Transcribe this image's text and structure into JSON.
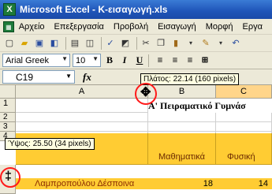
{
  "window": {
    "title": "Microsoft Excel - K-εισαγωγή.xls"
  },
  "menu": [
    "Αρχείο",
    "Επεξεργασία",
    "Προβολή",
    "Εισαγωγή",
    "Μορφή",
    "Εργα"
  ],
  "format_toolbar": {
    "font": "Arial Greek",
    "size": "10",
    "bold": "B",
    "italic": "I",
    "underline": "U"
  },
  "formula_bar": {
    "cell_ref": "C19",
    "fx": "fx"
  },
  "tooltips": {
    "column_width": "Πλάτος: 22.14 (160 pixels)",
    "row_height": "Ύψος: 25.50 (34 pixels)"
  },
  "columns": [
    "A",
    "B",
    "C"
  ],
  "rows": [
    "1",
    "2",
    "3",
    "4"
  ],
  "sheet": {
    "title": "Α' Πειραματικό Γυμνάσ",
    "subjects": [
      "Μαθηματικά",
      "Φυσική"
    ],
    "student_name": "Λαμπροπούλου Δέσποινα",
    "values": [
      "18",
      "14"
    ]
  },
  "colors": {
    "title_bar": "#1f54b8",
    "highlight_band": "#ffcc33",
    "red_circle": "#ff1a1a",
    "tooltip_bg": "#ffffe1"
  }
}
